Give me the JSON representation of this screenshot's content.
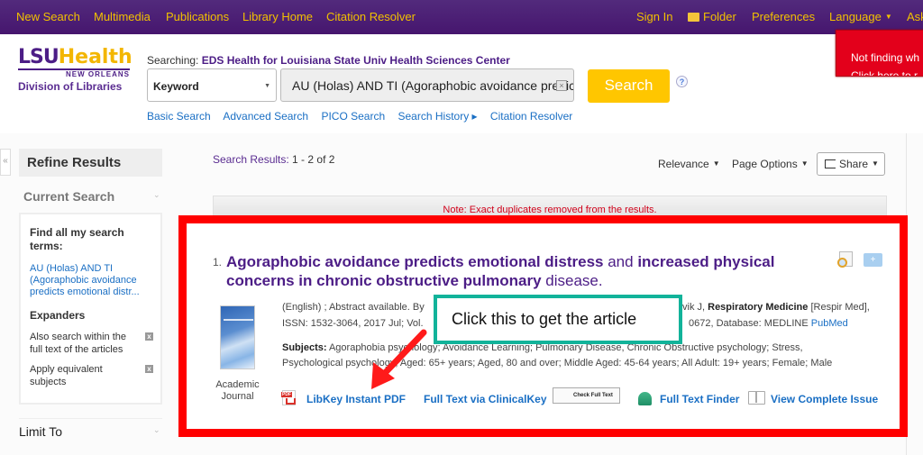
{
  "topnav": {
    "left": [
      "New Search",
      "Multimedia",
      "Publications",
      "Library Home",
      "Citation Resolver"
    ],
    "sign_in": "Sign In",
    "folder": "Folder",
    "preferences": "Preferences",
    "language": "Language",
    "ask": "Ask"
  },
  "brand": {
    "lsu": "LSU",
    "health": "Health",
    "new_orleans": "NEW ORLEANS",
    "division": "Division of Libraries",
    "color_purple": "#4c1d86",
    "color_gold": "#f3b600"
  },
  "search": {
    "searching_label": "Searching:",
    "database": "EDS Health for Louisiana State Univ Health Sciences Center",
    "field": "Keyword",
    "query": "AU (Holas) AND TI (Agoraphobic avoidance predicts emotional distress",
    "button": "Search",
    "help": "?",
    "links": [
      "Basic Search",
      "Advanced Search",
      "PICO Search",
      "Search History ▸",
      "Citation Resolver"
    ]
  },
  "banner": {
    "line1": "Not finding wh",
    "line2": "Click here to r"
  },
  "sidebar": {
    "collapse": "«",
    "refine_title": "Refine Results",
    "current_search": "Current Search",
    "find_all_label": "Find all my search terms:",
    "query_summary": "AU (Holas) AND TI (Agoraphobic avoidance predicts emotional distr...",
    "expanders_label": "Expanders",
    "expanders": [
      "Also search within the full text of the articles",
      "Apply equivalent subjects"
    ],
    "limit_to": "Limit To"
  },
  "results": {
    "label": "Search Results:",
    "range": "1 - 2 of 2",
    "sort": "Relevance",
    "page_options": "Page Options",
    "share": "Share",
    "note": "Note: Exact duplicates removed from the results."
  },
  "record": {
    "number": "1.",
    "title_parts": [
      {
        "text": "Agoraphobic avoidance predicts emotional distress",
        "bold": true
      },
      {
        "text": " and ",
        "bold": false
      },
      {
        "text": "increased physical concerns in chronic obstructive pulmonary",
        "bold": true
      },
      {
        "text": " disease.",
        "bold": false
      }
    ],
    "meta_line1_a": "(English) ; Abstract available. By",
    "meta_line1_b": "vik J, ",
    "journal": "Respiratory Medicine",
    "journal_abbr": " [Respir Med],",
    "meta_line2_a": "ISSN: 1532-3064, 2017 Jul; Vol.",
    "meta_line2_b": "0672, Database: MEDLINE ",
    "pubmed": "PubMed",
    "subjects_label": "Subjects:",
    "subjects_line1": " Agoraphobia psychology; Avoidance Learning; Pulmonary Disease, Chronic Obstructive psychology; Stress,",
    "subjects_line2": "Psychological psychology; Aged: 65+ years; Aged, 80 and over; Middle Aged: 45-64 years; All Adult: 19+ years; Female; Male",
    "pub_type": "Academic Journal",
    "links": {
      "libkey": "LibKey Instant PDF",
      "clinicalkey": "Full Text via ClinicalKey",
      "check_full_text": "Check Full Text",
      "finder": "Full Text Finder",
      "issue": "View Complete Issue"
    }
  },
  "annotation": {
    "callout": "Click this to get the article",
    "frame_color": "#ff0000",
    "callout_color": "#12b39a"
  }
}
